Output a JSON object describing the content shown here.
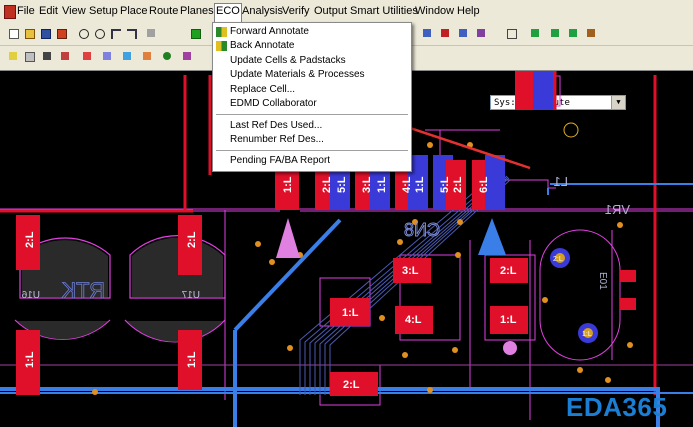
{
  "menubar": {
    "items": [
      "File",
      "Edit",
      "View",
      "Setup",
      "Place",
      "Route",
      "Planes",
      "ECO",
      "Analysis",
      "Verify",
      "Output",
      "Smart Utilities",
      "Window",
      "Help"
    ],
    "active": "ECO"
  },
  "toolbar": {
    "sys_combo_value": "Sys: T_B_Route"
  },
  "eco_menu": {
    "items": [
      {
        "label": "Forward Annotate",
        "icon": "forward-annotate-icon"
      },
      {
        "label": "Back Annotate",
        "icon": "back-annotate-icon"
      },
      {
        "label": "Update Cells & Padstacks",
        "icon": ""
      },
      {
        "label": "Update Materials & Processes",
        "icon": ""
      },
      {
        "label": "Replace Cell...",
        "icon": ""
      },
      {
        "label": "EDMD Collaborator",
        "icon": ""
      },
      {
        "label": "Last Ref Des Used...",
        "icon": ""
      },
      {
        "label": "Renumber Ref Des...",
        "icon": ""
      },
      {
        "label": "Pending FA/BA Report",
        "icon": ""
      }
    ]
  },
  "pcb": {
    "ref_labels": {
      "u16": "U16",
      "u17": "U17",
      "rtk": "RTK",
      "cn8": "CN8",
      "vr1": "VR1",
      "l1": "L1",
      "e01": "E01"
    },
    "pad_labels": {
      "p_left_top": "2:L",
      "p_left_bottom": "1:L",
      "p_mid_left": "2:L",
      "p_mid_bottom": "1:L",
      "p_conn1": "1:L",
      "p_conn2": "2:L",
      "p_conn3": "5:L",
      "p_conn4": "3:L",
      "p_conn5": "1:L",
      "p_conn6": "4:L",
      "p_conn7": "1:L",
      "p_conn8": "5:L",
      "p_conn9": "2:L",
      "p_conn10": "6:L",
      "p_c31": "3:L",
      "p_c11": "1:L",
      "p_c41": "4:L",
      "p_c21": "2:L",
      "p_c11b": "1:L",
      "p_c21b": "2:L",
      "p_bot": "2:L",
      "p_via21": "2:L",
      "p_via11": "1:L"
    }
  },
  "watermark": "EDA365",
  "colors": {
    "pad_red": "#e0102a",
    "pad_blue": "#3a3ad8",
    "trace_blue": "#3a7fe8",
    "outline_pink": "#e040e0",
    "menu_bg": "#ece9d8"
  }
}
